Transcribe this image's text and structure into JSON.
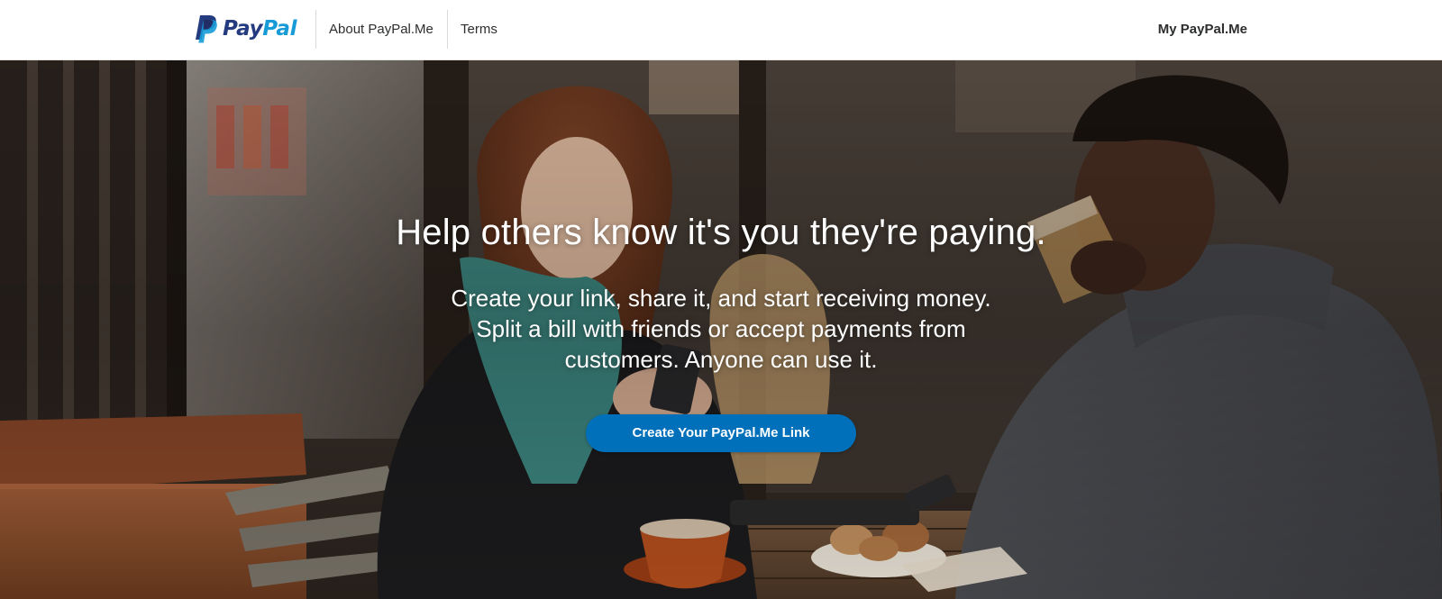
{
  "header": {
    "logo": {
      "pay": "Pay",
      "pal": "Pal",
      "alt": "PayPal"
    },
    "nav": {
      "about": "About PayPal.Me",
      "terms": "Terms",
      "my_paypal_me": "My PayPal.Me"
    }
  },
  "hero": {
    "title": "Help others know it's you they're paying.",
    "text": "Create your link, share it, and start receiving money. Split a bill with friends or accept payments from customers. Anyone can use it.",
    "cta_label": "Create Your PayPal.Me Link",
    "background_image": "cafe-photo"
  },
  "colors": {
    "brand_dark_blue": "#253b80",
    "brand_light_blue": "#179bd7",
    "button_blue": "#0070ba",
    "header_bg": "#ffffff",
    "nav_text": "#2c2e2f"
  }
}
